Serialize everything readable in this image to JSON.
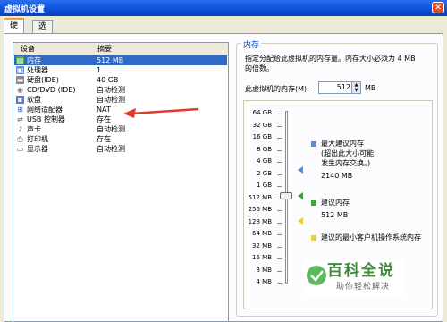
{
  "window": {
    "title": "虚拟机设置",
    "close_label": "✕"
  },
  "tabs": [
    {
      "label": "硬件",
      "active": true
    },
    {
      "label": "选项",
      "active": false
    }
  ],
  "device_list": {
    "columns": [
      "设备",
      "摘要"
    ],
    "rows": [
      {
        "device": "内存",
        "summary": "512 MB",
        "icon": "memory-icon",
        "selected": true
      },
      {
        "device": "处理器",
        "summary": "1",
        "icon": "processor-icon"
      },
      {
        "device": "硬盘(IDE)",
        "summary": "40 GB",
        "icon": "hard-disk-icon"
      },
      {
        "device": "CD/DVD (IDE)",
        "summary": "自动检测",
        "icon": "cd-dvd-icon"
      },
      {
        "device": "软盘",
        "summary": "自动检测",
        "icon": "floppy-icon"
      },
      {
        "device": "网络适配器",
        "summary": "NAT",
        "icon": "network-adapter-icon"
      },
      {
        "device": "USB 控制器",
        "summary": "存在",
        "icon": "usb-icon"
      },
      {
        "device": "声卡",
        "summary": "自动检测",
        "icon": "sound-card-icon"
      },
      {
        "device": "打印机",
        "summary": "存在",
        "icon": "printer-icon"
      },
      {
        "device": "显示器",
        "summary": "自动检测",
        "icon": "display-icon"
      }
    ]
  },
  "memory": {
    "group_title": "内存",
    "description_1": "指定分配给此虚拟机的内存量。内存大小必须为 4 MB",
    "description_2": "的倍数。",
    "field_label": "此虚拟机的内存(M):",
    "value": "512",
    "unit": "MB",
    "scale_ticks": [
      "64 GB",
      "32 GB",
      "16 GB",
      "8 GB",
      "4 GB",
      "2 GB",
      "1 GB",
      "512 MB",
      "256 MB",
      "128 MB",
      "64 MB",
      "32 MB",
      "16 MB",
      "8 MB",
      "4 MB"
    ],
    "legend": {
      "max_label": "最大建议内存",
      "max_note_1": "(超出此大小可能",
      "max_note_2": "发生内存交换。)",
      "max_value": "2140 MB",
      "recommended_label": "建议内存",
      "recommended_value": "512 MB",
      "min_label": "建议的最小客户机操作系统内存"
    },
    "colors": {
      "max": "#5b8bd1",
      "recommended": "#3aa53a",
      "min": "#e6d23a"
    }
  },
  "annotation_arrow": {
    "color": "#e03a2a",
    "points_to": "网络适配器"
  },
  "watermark": {
    "title": "百科全说",
    "subtitle": "助你轻松解决"
  }
}
